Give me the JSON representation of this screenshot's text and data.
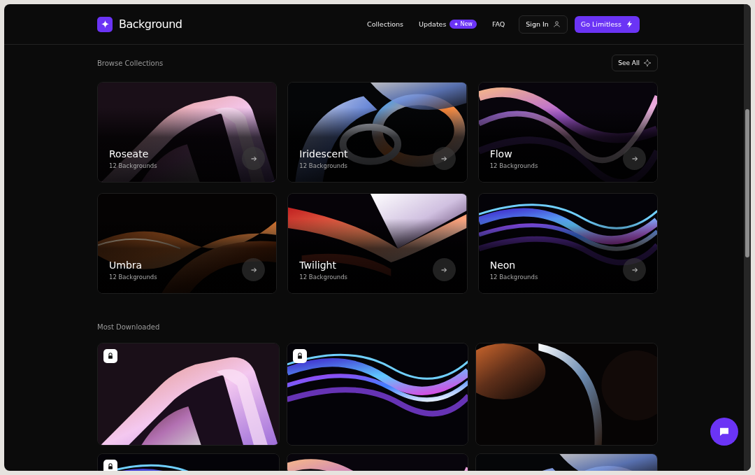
{
  "header": {
    "logo": "Background",
    "nav": [
      {
        "label": "Collections"
      },
      {
        "label": "Updates",
        "badge": "New"
      },
      {
        "label": "FAQ"
      }
    ],
    "sign_in": "Sign In",
    "cta": "Go Limitless"
  },
  "collections": {
    "title": "Browse Collections",
    "see_all": "See All",
    "items": [
      {
        "name": "Roseate",
        "count": "12 Backgrounds"
      },
      {
        "name": "Iridescent",
        "count": "12 Backgrounds"
      },
      {
        "name": "Flow",
        "count": "12 Backgrounds"
      },
      {
        "name": "Umbra",
        "count": "12 Backgrounds"
      },
      {
        "name": "Twilight",
        "count": "12 Backgrounds"
      },
      {
        "name": "Neon",
        "count": "12 Backgrounds"
      }
    ]
  },
  "most_downloaded": {
    "title": "Most Downloaded",
    "items": [
      {
        "locked": true
      },
      {
        "locked": true
      },
      {
        "locked": false
      },
      {
        "locked": true
      },
      {
        "locked": false
      },
      {
        "locked": false
      }
    ]
  }
}
